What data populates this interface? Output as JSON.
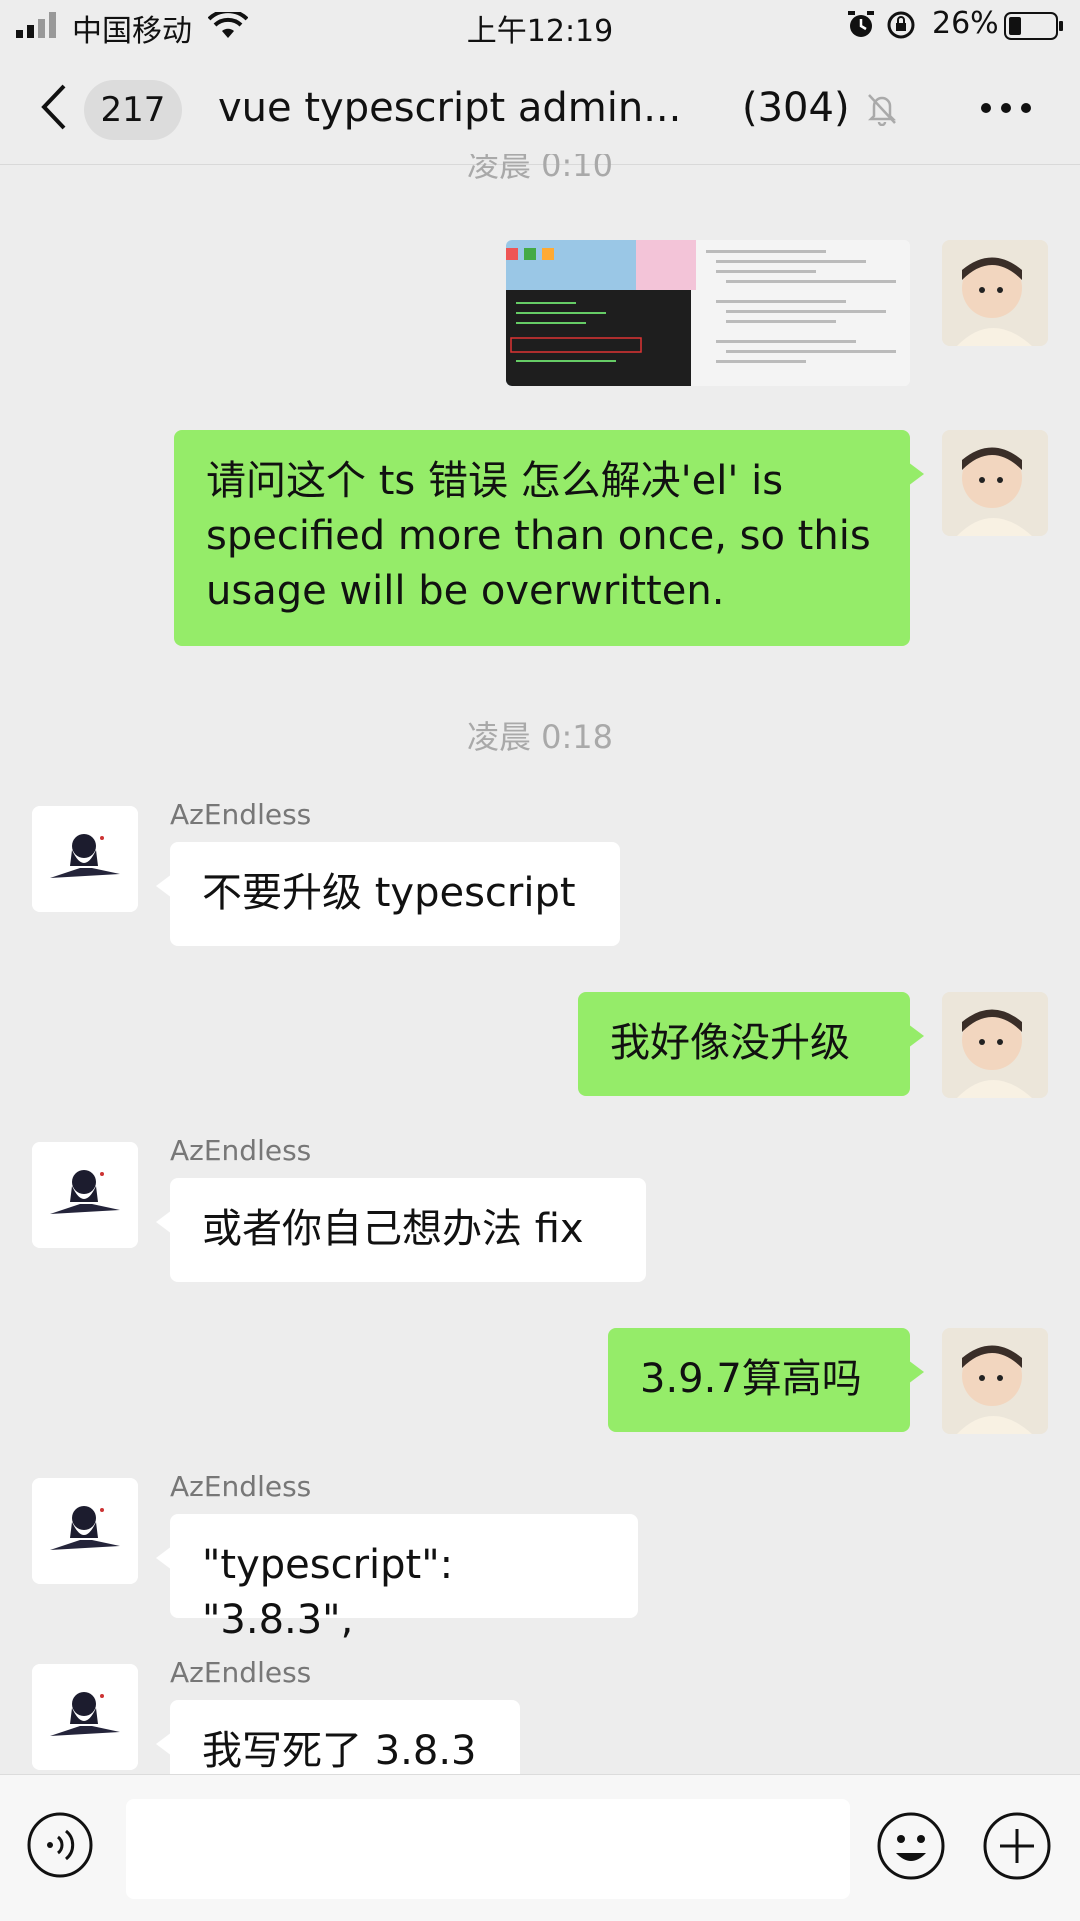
{
  "status_bar": {
    "carrier": "中国移动",
    "time": "上午12:19",
    "battery": "26%"
  },
  "header": {
    "unread_count": "217",
    "title": "vue typescript admin...",
    "member_count": "(304)"
  },
  "messages": {
    "ts_cut": "凌晨 0:10",
    "ts_1": "凌晨 0:18",
    "m2_line1": "请问这个 ts 错误 怎么解决'el' is",
    "m2_line2": "specified more than once, so this",
    "m2_line3": "usage will be overwritten.",
    "sender_1": "AzEndless",
    "m3": "不要升级 typescript",
    "m4": "我好像没升级",
    "sender_2": "AzEndless",
    "m5": "或者你自己想办法 fix",
    "m6": "3.9.7算高吗",
    "sender_3": "AzEndless",
    "m7": "\"typescript\": \"3.8.3\",",
    "sender_4": "AzEndless",
    "m8": "我写死了 3.8.3"
  },
  "input": {
    "placeholder": ""
  },
  "colors": {
    "outgoing": "#95ec69",
    "incoming": "#ffffff",
    "background": "#ededed"
  },
  "icons": [
    "signal-icon",
    "wifi-icon",
    "alarm-icon",
    "rotation-lock-icon",
    "battery-icon",
    "back-icon",
    "mute-icon",
    "more-icon",
    "voice-icon",
    "emoji-icon",
    "plus-icon"
  ]
}
